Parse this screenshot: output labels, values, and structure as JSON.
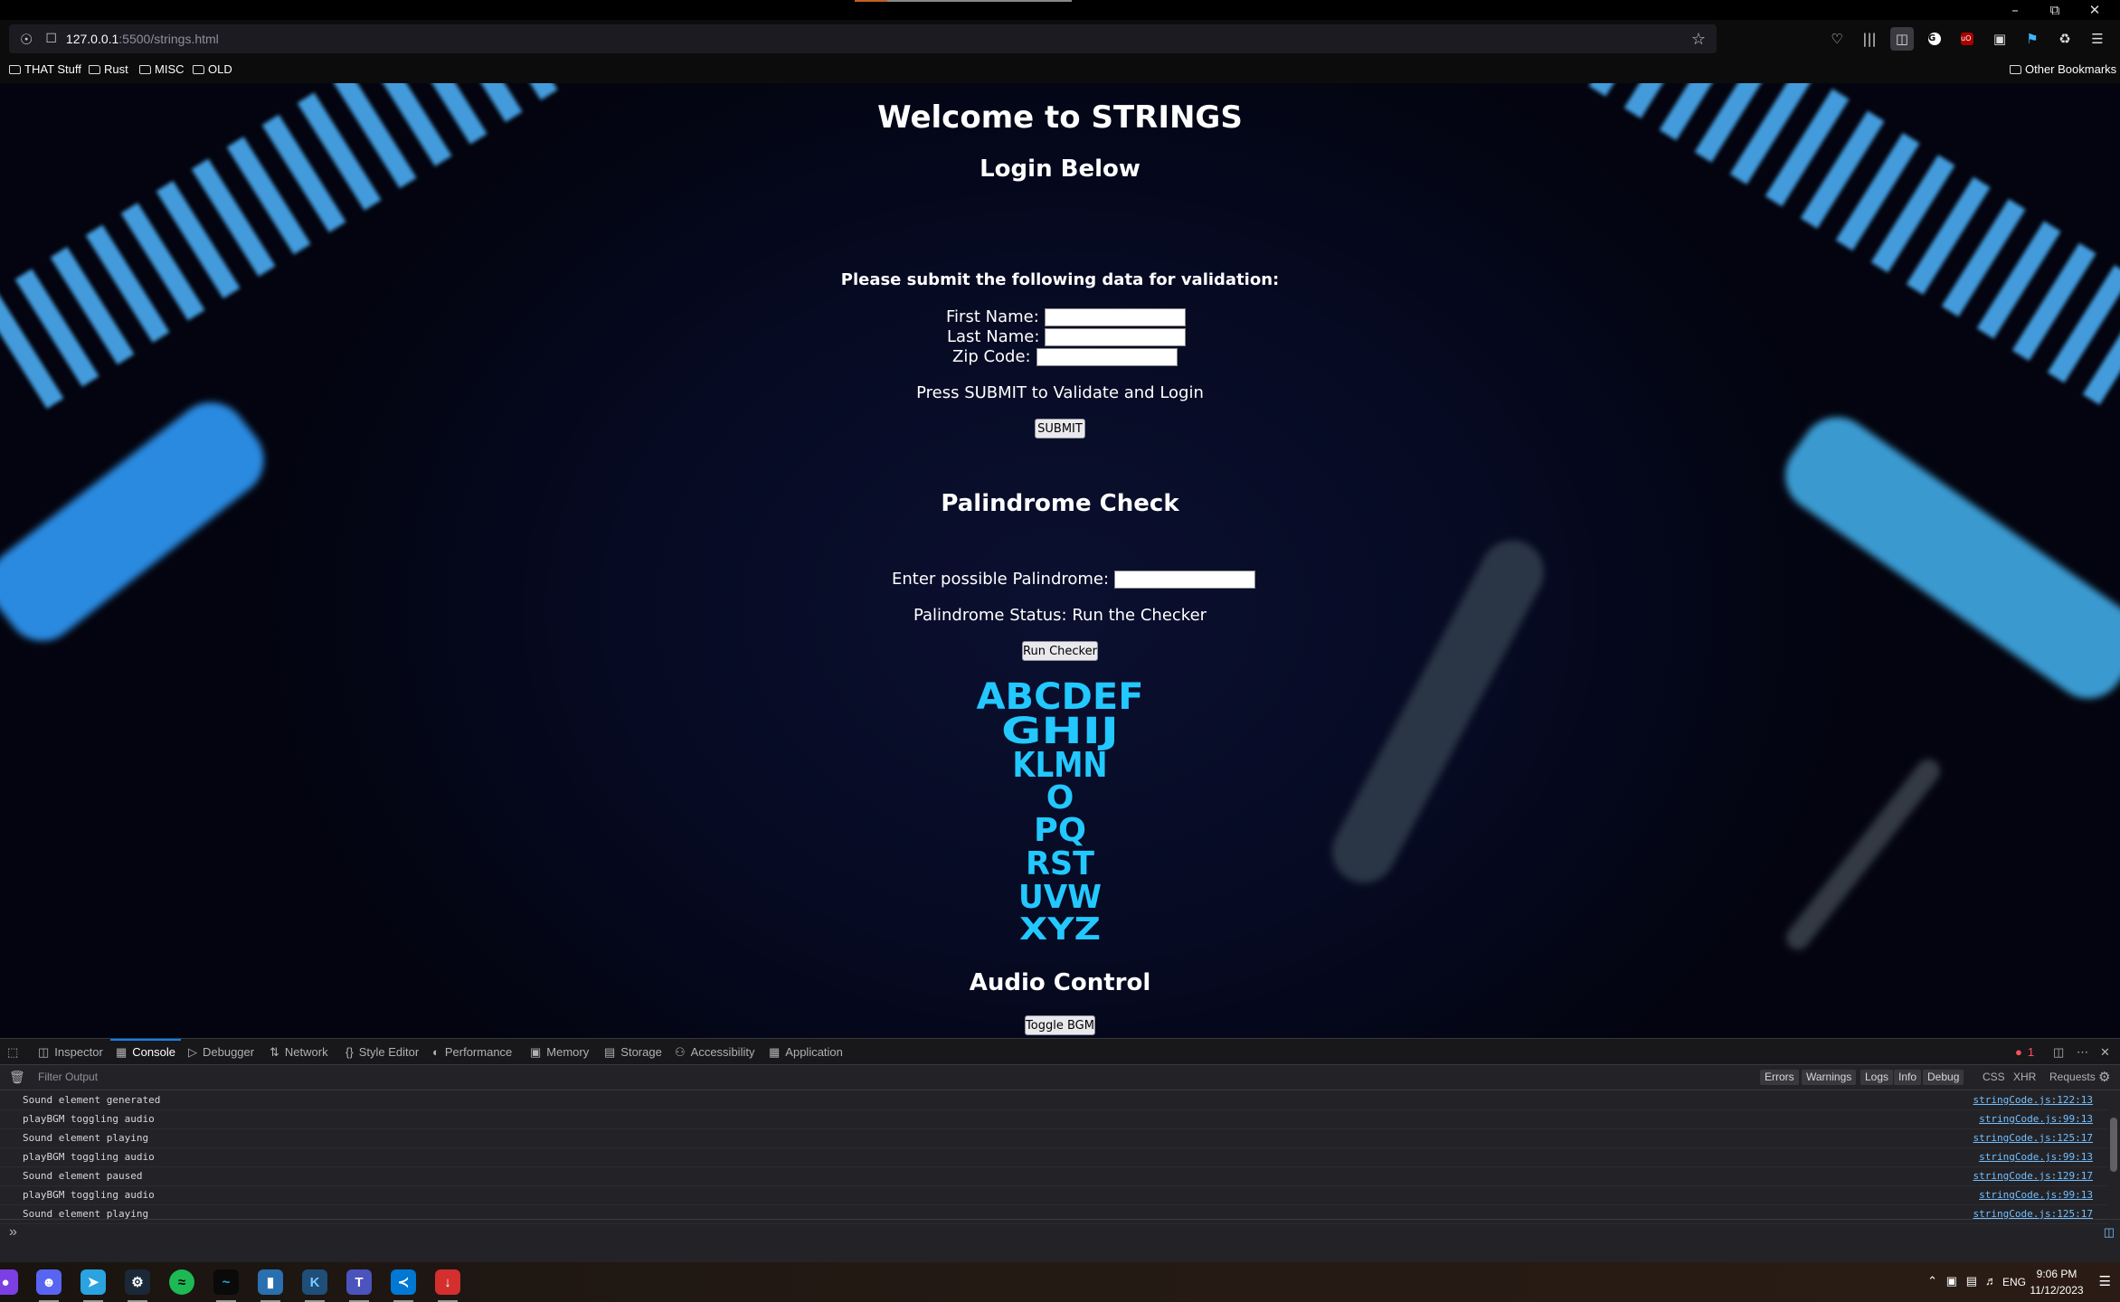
{
  "browser": {
    "url_host": "127.0.0.1",
    "url_path": ":5500/strings.html",
    "bookmarks": [
      "THAT Stuff",
      "Rust",
      "MISC",
      "OLD"
    ],
    "other_bookmarks": "Other Bookmarks"
  },
  "page": {
    "title": "Welcome to STRINGS",
    "login_heading": "Login Below",
    "instructions": "Please submit the following data for validation:",
    "first_name_label": "First Name:",
    "last_name_label": "Last Name:",
    "zip_label": "Zip Code:",
    "submit_prompt": "Press SUBMIT to Validate and Login",
    "submit_button": "SUBMIT",
    "palindrome_heading": "Palindrome Check",
    "palindrome_label": "Enter possible Palindrome:",
    "palindrome_status": "Palindrome Status: Run the Checker",
    "run_checker_button": "Run Checker",
    "logo_rows": [
      "ABCDEF",
      "GHIJ",
      "KLMN",
      "O",
      "PQ",
      "RST",
      "UVW",
      "XYZ"
    ],
    "audio_heading": "Audio Control",
    "toggle_bgm_button": "Toggle BGM",
    "accent_color": "#22c8ff"
  },
  "devtools": {
    "tabs": [
      {
        "label": "Inspector",
        "icon": "inspector-icon"
      },
      {
        "label": "Console",
        "icon": "console-icon",
        "active": true
      },
      {
        "label": "Debugger",
        "icon": "debugger-icon"
      },
      {
        "label": "Network",
        "icon": "network-icon"
      },
      {
        "label": "Style Editor",
        "icon": "style-editor-icon"
      },
      {
        "label": "Performance",
        "icon": "performance-icon"
      },
      {
        "label": "Memory",
        "icon": "memory-icon"
      },
      {
        "label": "Storage",
        "icon": "storage-icon"
      },
      {
        "label": "Accessibility",
        "icon": "accessibility-icon"
      },
      {
        "label": "Application",
        "icon": "application-icon"
      }
    ],
    "error_count": "1",
    "filter_placeholder": "Filter Output",
    "filters": [
      "Errors",
      "Warnings",
      "Logs",
      "Info",
      "Debug"
    ],
    "net_filters": [
      "CSS",
      "XHR",
      "Requests"
    ],
    "log": [
      {
        "msg": "Sound element generated",
        "src": "stringCode.js:122:13"
      },
      {
        "msg": "playBGM toggling audio",
        "src": "stringCode.js:99:13"
      },
      {
        "msg": "Sound element playing",
        "src": "stringCode.js:125:17"
      },
      {
        "msg": "playBGM toggling audio",
        "src": "stringCode.js:99:13"
      },
      {
        "msg": "Sound element paused",
        "src": "stringCode.js:129:17"
      },
      {
        "msg": "playBGM toggling audio",
        "src": "stringCode.js:99:13"
      },
      {
        "msg": "Sound element playing",
        "src": "stringCode.js:125:17"
      }
    ]
  },
  "taskbar": {
    "language": "ENG",
    "time": "9:06 PM",
    "date": "11/12/2023"
  }
}
